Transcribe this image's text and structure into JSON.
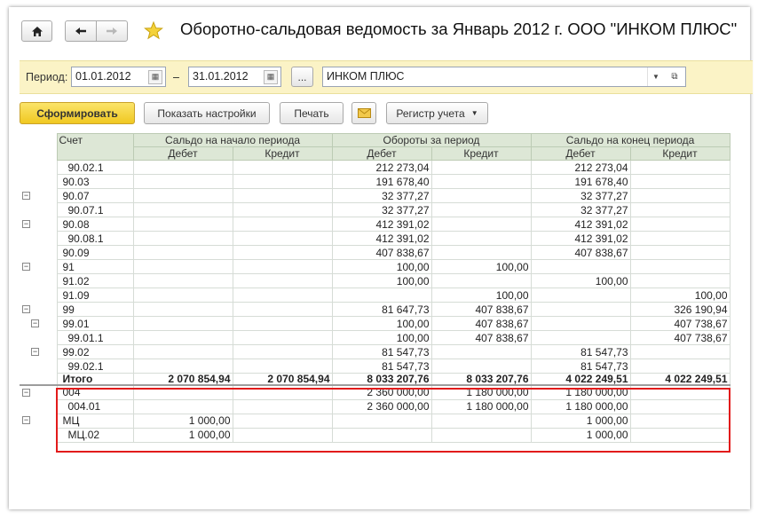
{
  "toolbar": {
    "title": "Оборотно-сальдовая ведомость за Январь 2012 г. ООО \"ИНКОМ ПЛЮС\""
  },
  "params": {
    "period_label": "Период:",
    "date_from": "01.01.2012",
    "dash": "–",
    "date_to": "31.01.2012",
    "more_label": "...",
    "org": "ИНКОМ ПЛЮС"
  },
  "actions": {
    "generate": "Сформировать",
    "show_settings": "Показать настройки",
    "print": "Печать",
    "register": "Регистр учета"
  },
  "table": {
    "col_account": "Счет",
    "groups": [
      "Сальдо на начало периода",
      "Обороты за период",
      "Сальдо на конец периода"
    ],
    "sub_debit": "Дебет",
    "sub_credit": "Кредит",
    "rows": [
      {
        "account": "90.02.1",
        "indent": 1,
        "od": "",
        "oc": "",
        "td": "212 273,04",
        "tc": "",
        "cd": "212 273,04",
        "cc": ""
      },
      {
        "account": "90.03",
        "indent": 0,
        "od": "",
        "oc": "",
        "td": "191 678,40",
        "tc": "",
        "cd": "191 678,40",
        "cc": ""
      },
      {
        "account": "90.07",
        "indent": 0,
        "od": "",
        "oc": "",
        "td": "32 377,27",
        "tc": "",
        "cd": "32 377,27",
        "cc": ""
      },
      {
        "account": "90.07.1",
        "indent": 1,
        "od": "",
        "oc": "",
        "td": "32 377,27",
        "tc": "",
        "cd": "32 377,27",
        "cc": ""
      },
      {
        "account": "90.08",
        "indent": 0,
        "od": "",
        "oc": "",
        "td": "412 391,02",
        "tc": "",
        "cd": "412 391,02",
        "cc": ""
      },
      {
        "account": "90.08.1",
        "indent": 1,
        "od": "",
        "oc": "",
        "td": "412 391,02",
        "tc": "",
        "cd": "412 391,02",
        "cc": ""
      },
      {
        "account": "90.09",
        "indent": 0,
        "od": "",
        "oc": "",
        "td": "407 838,67",
        "tc": "",
        "cd": "407 838,67",
        "cc": ""
      },
      {
        "account": "91",
        "indent": 0,
        "od": "",
        "oc": "",
        "td": "100,00",
        "tc": "100,00",
        "cd": "",
        "cc": ""
      },
      {
        "account": "91.02",
        "indent": 0,
        "od": "",
        "oc": "",
        "td": "100,00",
        "tc": "",
        "cd": "100,00",
        "cc": ""
      },
      {
        "account": "91.09",
        "indent": 0,
        "od": "",
        "oc": "",
        "td": "",
        "tc": "100,00",
        "cd": "",
        "cc": "100,00"
      },
      {
        "account": "99",
        "indent": 0,
        "od": "",
        "oc": "",
        "td": "81 647,73",
        "tc": "407 838,67",
        "cd": "",
        "cc": "326 190,94"
      },
      {
        "account": "99.01",
        "indent": 0,
        "od": "",
        "oc": "",
        "td": "100,00",
        "tc": "407 838,67",
        "cd": "",
        "cc": "407 738,67"
      },
      {
        "account": "99.01.1",
        "indent": 1,
        "od": "",
        "oc": "",
        "td": "100,00",
        "tc": "407 838,67",
        "cd": "",
        "cc": "407 738,67"
      },
      {
        "account": "99.02",
        "indent": 0,
        "od": "",
        "oc": "",
        "td": "81 547,73",
        "tc": "",
        "cd": "81 547,73",
        "cc": ""
      },
      {
        "account": "99.02.1",
        "indent": 1,
        "od": "",
        "oc": "",
        "td": "81 547,73",
        "tc": "",
        "cd": "81 547,73",
        "cc": ""
      }
    ],
    "total": {
      "account": "Итого",
      "od": "2 070 854,94",
      "oc": "2 070 854,94",
      "td": "8 033 207,76",
      "tc": "8 033 207,76",
      "cd": "4 022 249,51",
      "cc": "4 022 249,51"
    },
    "offbalance": [
      {
        "account": "004",
        "indent": 0,
        "od": "",
        "oc": "",
        "td": "2 360 000,00",
        "tc": "1 180 000,00",
        "cd": "1 180 000,00",
        "cc": ""
      },
      {
        "account": "004.01",
        "indent": 1,
        "od": "",
        "oc": "",
        "td": "2 360 000,00",
        "tc": "1 180 000,00",
        "cd": "1 180 000,00",
        "cc": ""
      },
      {
        "account": "МЦ",
        "indent": 0,
        "od": "1 000,00",
        "oc": "",
        "td": "",
        "tc": "",
        "cd": "1 000,00",
        "cc": ""
      },
      {
        "account": "МЦ.02",
        "indent": 1,
        "od": "1 000,00",
        "oc": "",
        "td": "",
        "tc": "",
        "cd": "1 000,00",
        "cc": ""
      }
    ]
  },
  "colors": {
    "accent_button": "#f5d43c",
    "header_bg": "#dde7d6",
    "param_bar": "#fbf3c6",
    "highlight_box": "#e21b1b"
  }
}
